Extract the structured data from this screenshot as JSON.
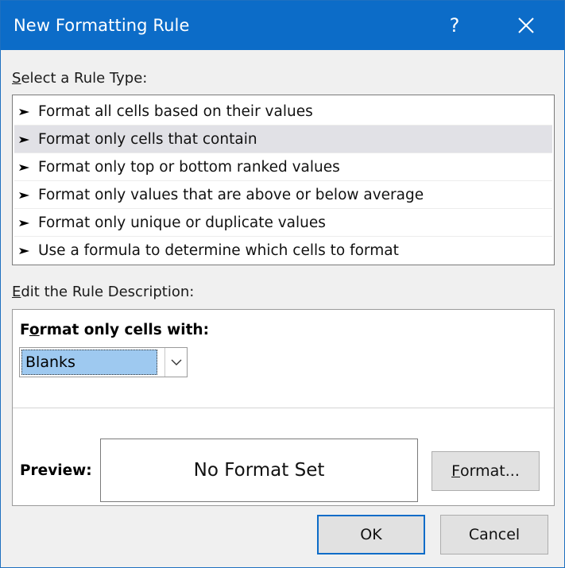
{
  "window": {
    "title": "New Formatting Rule",
    "help_label": "?",
    "close_icon": "close-icon"
  },
  "rule_type": {
    "label_accel": "S",
    "label_rest": "elect a Rule Type:",
    "selected_index": 1,
    "items": [
      {
        "label": "Format all cells based on their values"
      },
      {
        "label": "Format only cells that contain"
      },
      {
        "label": "Format only top or bottom ranked values"
      },
      {
        "label": "Format only values that are above or below average"
      },
      {
        "label": "Format only unique or duplicate values"
      },
      {
        "label": "Use a formula to determine which cells to format"
      }
    ]
  },
  "description": {
    "label_accel": "E",
    "label_rest": "dit the Rule Description:",
    "condition_label_pre": "F",
    "condition_label_accel": "o",
    "condition_label_rest": "rmat only cells with:",
    "condition_value": "Blanks",
    "preview_label": "Preview:",
    "preview_text": "No Format Set",
    "format_button_accel": "F",
    "format_button_rest": "ormat..."
  },
  "buttons": {
    "ok": "OK",
    "cancel": "Cancel"
  },
  "colors": {
    "titlebar": "#0c6cc8",
    "selected_row": "#e1e1e6",
    "combo_highlight": "#9ec9f0",
    "default_button_border": "#0c6cc8"
  }
}
